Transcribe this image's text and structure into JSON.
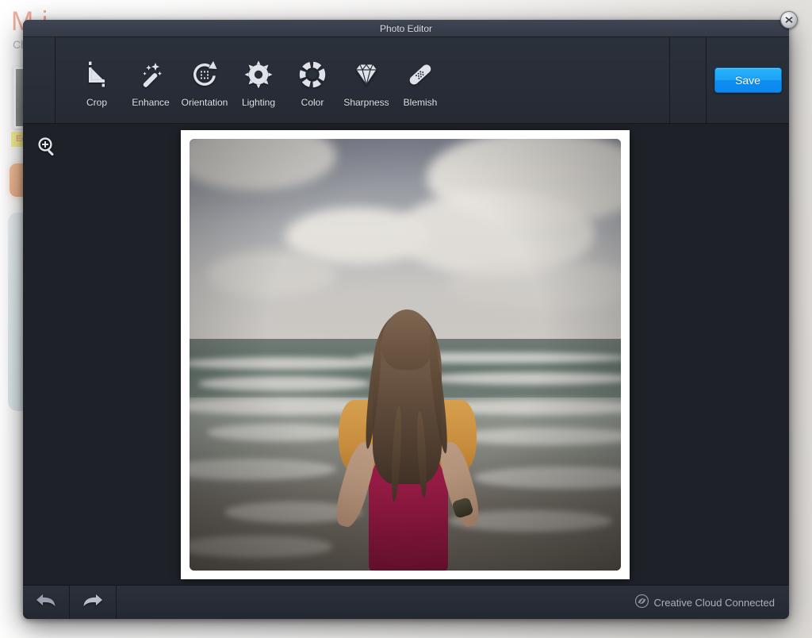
{
  "background_page": {
    "title": "M                  i",
    "subtitle": "Ch",
    "edit_badge": "Edit",
    "thumbnail_name": "photo-thumbnail",
    "orange_button_name": "primary-action-button",
    "blue_panel_name": "side-panel"
  },
  "window": {
    "title": "Photo Editor",
    "close_label": "X",
    "close_icon": "close-icon"
  },
  "toolbar": {
    "tools": [
      {
        "label": "Crop",
        "icon": "crop-icon"
      },
      {
        "label": "Enhance",
        "icon": "magic-wand-icon"
      },
      {
        "label": "Orientation",
        "icon": "rotate-icon"
      },
      {
        "label": "Lighting",
        "icon": "sun-icon"
      },
      {
        "label": "Color",
        "icon": "color-wheel-icon"
      },
      {
        "label": "Sharpness",
        "icon": "diamond-icon"
      },
      {
        "label": "Blemish",
        "icon": "bandage-icon"
      }
    ],
    "save_label": "Save"
  },
  "canvas": {
    "zoom_tool_icon": "zoom-in-icon",
    "photo": {
      "name": "edited-photo",
      "description": "Girl standing with hands on hips facing the ocean on a cloudy beach"
    }
  },
  "bottombar": {
    "undo_icon": "undo-arrow-icon",
    "redo_icon": "redo-arrow-icon",
    "status_icon": "creative-cloud-icon",
    "status_text": "Creative Cloud Connected"
  },
  "colors": {
    "accent_save": "#1ea2f5",
    "window_chrome": "#2b313b",
    "titlebar": "#3a4150",
    "canvas_bg": "#1e2228",
    "brand_orange": "#e8502a",
    "badge_yellow": "#f2ee14"
  }
}
